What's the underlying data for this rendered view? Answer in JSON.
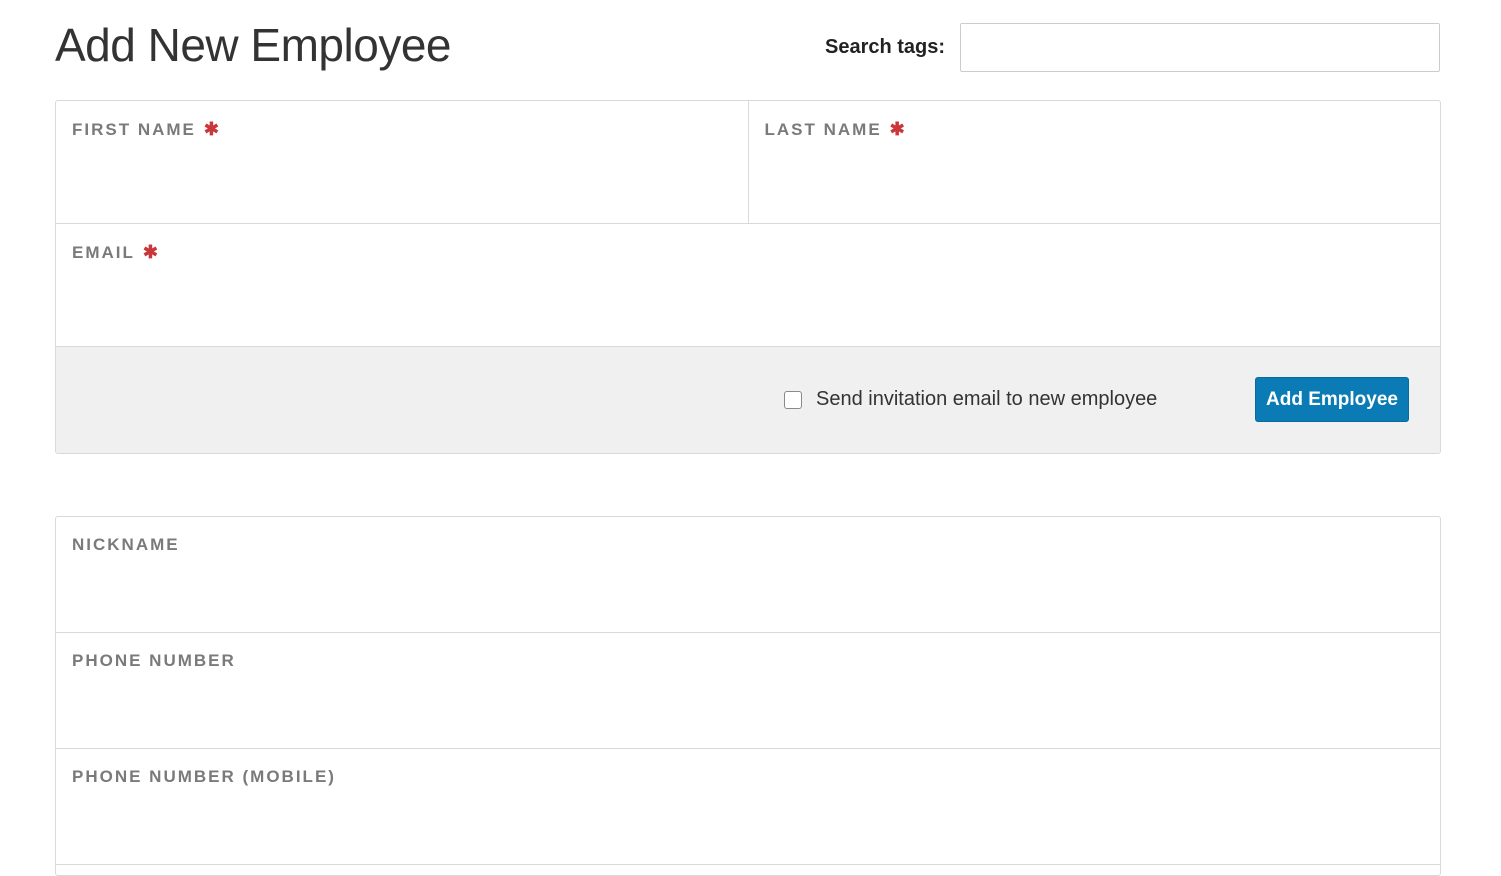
{
  "page": {
    "title": "Add New Employee"
  },
  "search": {
    "label": "Search tags:",
    "value": "",
    "placeholder": ""
  },
  "primary_form": {
    "first_name": {
      "label": "FIRST NAME",
      "required_mark": "✱",
      "value": ""
    },
    "last_name": {
      "label": "LAST NAME",
      "required_mark": "✱",
      "value": ""
    },
    "email": {
      "label": "EMAIL",
      "required_mark": "✱",
      "value": ""
    },
    "footer": {
      "invite_label": "Send invitation email to new employee",
      "invite_checked": false,
      "submit_label": "Add Employee"
    }
  },
  "secondary_form": {
    "nickname": {
      "label": "NICKNAME",
      "value": ""
    },
    "phone": {
      "label": "PHONE NUMBER",
      "value": ""
    },
    "phone_mobile": {
      "label": "PHONE NUMBER (MOBILE)",
      "value": ""
    }
  },
  "colors": {
    "accent": "#0a7bb5",
    "required": "#c9373a",
    "label": "#7a7a7a",
    "footer_bg": "#f0f0f0",
    "border": "#d9d9d9"
  }
}
